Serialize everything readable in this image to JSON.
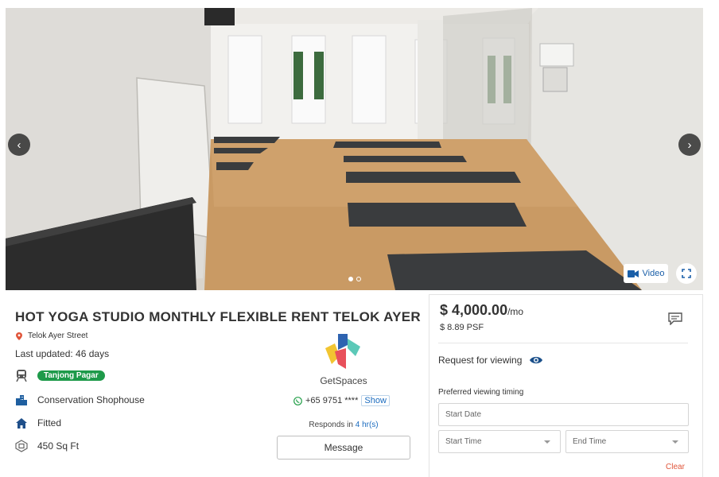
{
  "gallery": {
    "slide_count": 2,
    "active_slide": 1,
    "video_label": "Video",
    "prev_icon": "chevron-left-icon",
    "next_icon": "chevron-right-icon"
  },
  "listing": {
    "title": "HOT YOGA STUDIO MONTHLY FLEXIBLE RENT TELOK AYER",
    "address": "Telok Ayer Street",
    "last_updated": "Last updated: 46 days",
    "mrt": "Tanjong Pagar",
    "property_type": "Conservation Shophouse",
    "furnishing": "Fitted",
    "size": "450 Sq Ft"
  },
  "agent": {
    "name": "GetSpaces",
    "phone": "+65 9751 ****",
    "show_label": "Show",
    "responds_prefix": "Responds in",
    "responds_time": "4 hr(s)",
    "message_label": "Message"
  },
  "pricing": {
    "price": "$ 4,000.00",
    "per": "/mo",
    "psf": "$ 8.89 PSF"
  },
  "viewing": {
    "request_label": "Request for viewing",
    "preferred_label": "Preferred viewing timing",
    "start_date_placeholder": "Start Date",
    "start_time_placeholder": "Start Time",
    "end_time_placeholder": "End Time",
    "clear_label": "Clear"
  },
  "colors": {
    "mrt_badge": "#1e9a4a",
    "link": "#1a6bbf",
    "clear": "#e0553a",
    "pin": "#e0553a",
    "eye": "#1a4f8a"
  }
}
